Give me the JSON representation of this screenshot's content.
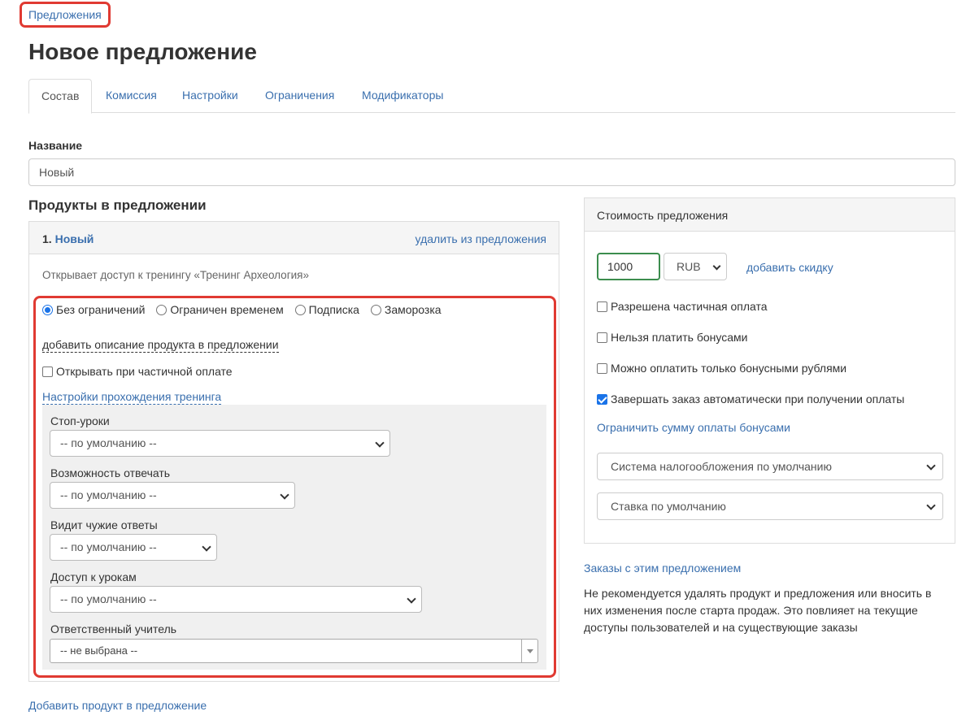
{
  "breadcrumb": "Предложения",
  "page_title": "Новое предложение",
  "tabs": [
    "Состав",
    "Комиссия",
    "Настройки",
    "Ограничения",
    "Модификаторы"
  ],
  "name_field": {
    "label": "Название",
    "value": "Новый"
  },
  "products_section": {
    "title": "Продукты в предложении",
    "product": {
      "number": "1.",
      "name": "Новый",
      "remove_label": "удалить из предложения",
      "description": "Открывает доступ к тренингу «Тренинг Археология»",
      "access_modes": [
        "Без ограничений",
        "Ограничен временем",
        "Подписка",
        "Заморозка"
      ],
      "selected_mode": "Без ограничений",
      "add_description_link": "добавить описание продукта в предложении",
      "open_on_partial": {
        "label": "Открывать при частичной оплате",
        "checked": false
      },
      "training_settings_link": "Настройки прохождения тренинга",
      "fields": [
        {
          "label": "Стоп-уроки",
          "value": "-- по умолчанию --"
        },
        {
          "label": "Возможность отвечать",
          "value": "-- по умолчанию --"
        },
        {
          "label": "Видит чужие ответы",
          "value": "-- по умолчанию --"
        },
        {
          "label": "Доступ к урокам",
          "value": "-- по умолчанию --"
        },
        {
          "label": "Ответственный учитель",
          "value": "-- не выбрана --"
        }
      ]
    },
    "add_product_link": "Добавить продукт в предложение"
  },
  "price_panel": {
    "title": "Стоимость предложения",
    "price": "1000",
    "currency": "RUB",
    "add_discount": "добавить скидку",
    "checkboxes": [
      {
        "label": "Разрешена частичная оплата",
        "checked": false
      },
      {
        "label": "Нельзя платить бонусами",
        "checked": false
      },
      {
        "label": "Можно оплатить только бонусными рублями",
        "checked": false
      },
      {
        "label": "Завершать заказ автоматически при получении оплаты",
        "checked": true
      }
    ],
    "limit_bonus_link": "Ограничить сумму оплаты бонусами",
    "tax_system": "Система налогообложения по умолчанию",
    "tax_rate": "Ставка по умолчанию"
  },
  "orders_link": "Заказы с этим предложением",
  "warning_text": "Не рекомендуется удалять продукт и предложения или вносить в них изменения после старта продаж. Это повлияет на текущие доступы пользователей и на существующие заказы",
  "colors": {
    "link": "#3a6fae",
    "highlight": "#e03a32",
    "checkbox": "#1a73e8",
    "price_border": "#3c8d4e"
  }
}
